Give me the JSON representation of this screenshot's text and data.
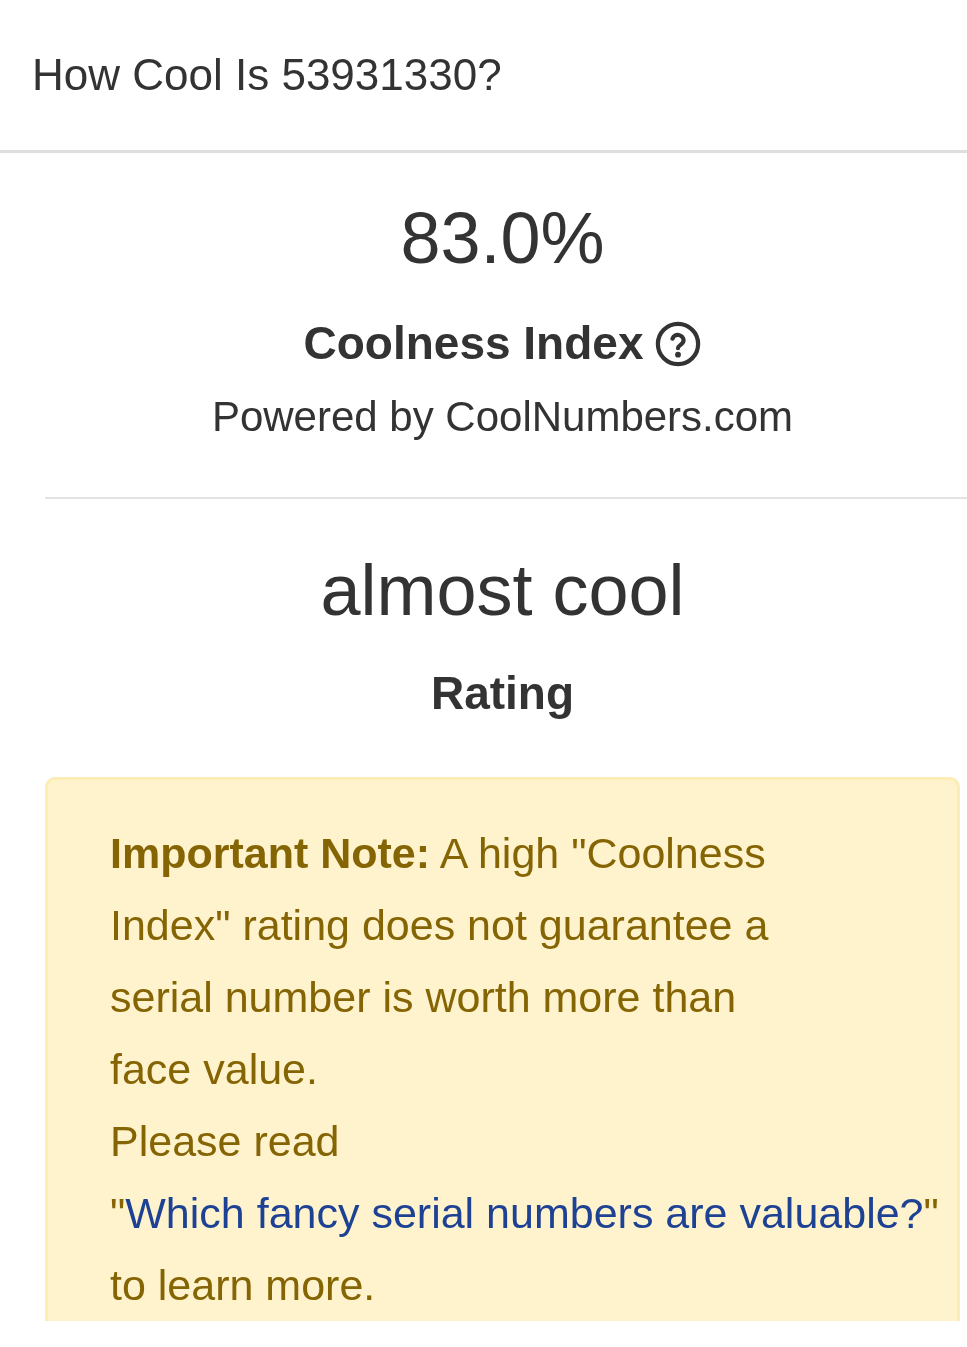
{
  "header": {
    "title": "How Cool Is 53931330?"
  },
  "score": {
    "value": "83.0%",
    "label": "Coolness Index",
    "attribution": "Powered by CoolNumbers.com"
  },
  "rating": {
    "value": "almost cool",
    "label": "Rating"
  },
  "note": {
    "text": "**Important Note:** A high \"Coolness Index\" rating does not guarantee a serial number is worth more than face value.",
    "link_prefix": "Please read \"",
    "link": "Which fancy serial numbers are valuable?",
    "link_suffix": "\" to learn more."
  }
}
